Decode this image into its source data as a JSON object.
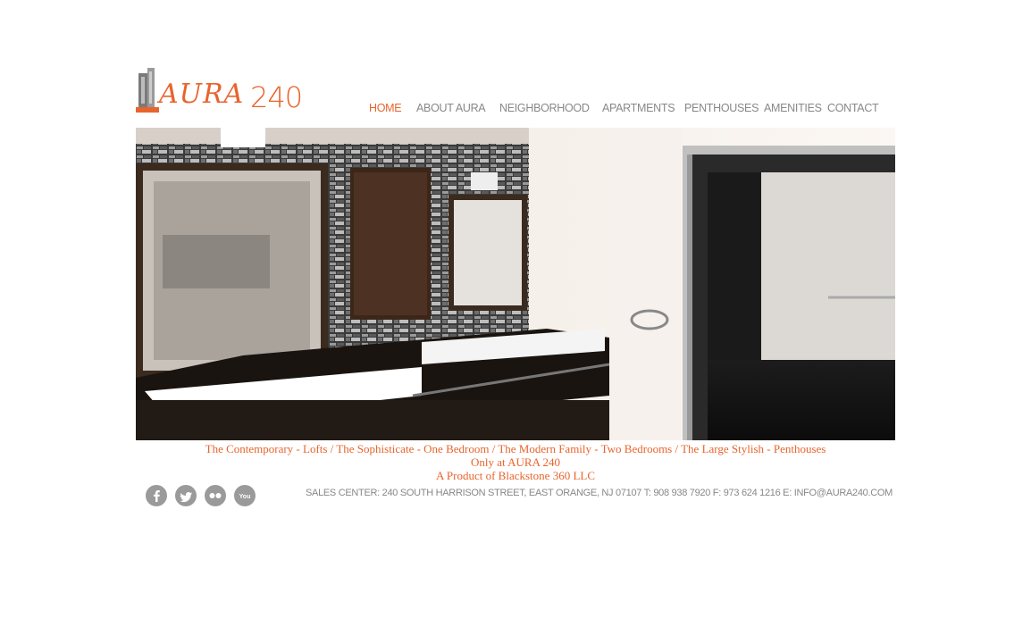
{
  "brand": {
    "word": "AURA",
    "number": "240"
  },
  "nav": [
    {
      "label": "HOME",
      "active": true
    },
    {
      "label": "ABOUT AURA"
    },
    {
      "label": "NEIGHBORHOOD"
    },
    {
      "label": "APARTMENTS"
    },
    {
      "label": "PENTHOUSES"
    },
    {
      "label": "AMENITIES"
    },
    {
      "label": "CONTACT"
    }
  ],
  "tagline": {
    "line1": "The Contemporary - Lofts / The Sophisticate - One Bedroom / The Modern Family - Two Bedrooms / The Large Stylish - Penthouses",
    "line2": "Only at AURA 240",
    "line3": "A Product of Blackstone 360 LLC"
  },
  "social": [
    {
      "icon": "facebook-icon"
    },
    {
      "icon": "twitter-icon"
    },
    {
      "icon": "flickr-icon"
    },
    {
      "icon": "youtube-icon"
    }
  ],
  "footer": {
    "text": "SALES CENTER: 240 SOUTH HARRISON STREET, EAST ORANGE, NJ 07107 T: 908 938 7920 F: 973 624 1216 E: INFO@AURA240.COM"
  },
  "colors": {
    "accent": "#e8642c",
    "nav": "#888888",
    "social": "#9a9a9a"
  }
}
